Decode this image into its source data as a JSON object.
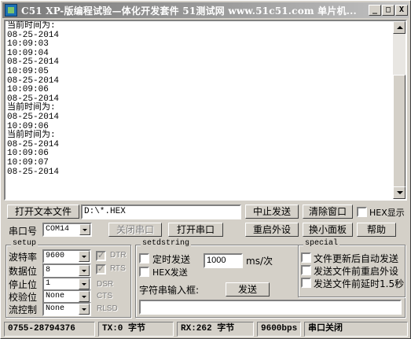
{
  "window": {
    "title": "C51 XP-版编程试验—体化开发套件 51测试网 www.51c51.com 单片机...",
    "min": "_",
    "max": "□",
    "close": "X"
  },
  "receive": {
    "lines": [
      "当前时间为:",
      "08-25-2014",
      "10:09:03",
      "10:09:04",
      "08-25-2014",
      "10:09:05",
      "08-25-2014",
      "10:09:06",
      "08-25-2014",
      "当前时间为:",
      "08-25-2014",
      "10:09:06",
      "当前时间为:",
      "08-25-2014",
      "10:09:06",
      "10:09:07",
      "08-25-2014"
    ]
  },
  "file_row": {
    "open_file": "打开文本文件",
    "path": "D:\\*.HEX",
    "stop_send": "中止发送",
    "clear_window": "清除窗口",
    "hex_display": "HEX显示"
  },
  "port_row": {
    "port_label": "串口号",
    "port_value": "COM14",
    "close_port": "关闭串口",
    "open_port": "打开串口",
    "restart": "重启外设",
    "switch_panel": "换小面板",
    "help": "帮助"
  },
  "setup": {
    "title": "setup",
    "baud_label": "波特率",
    "baud": "9600",
    "data_label": "数据位",
    "data": "8",
    "stop_label": "停止位",
    "stop": "1",
    "parity_label": "校验位",
    "parity": "None",
    "flow_label": "流控制",
    "flow": "None",
    "dtr": "DTR",
    "rts": "RTS",
    "dsr": "DSR",
    "cts": "CTS",
    "rlsd": "RLSD"
  },
  "setdstring": {
    "title": "setdstring",
    "timed_send": "定时发送",
    "interval": "1000",
    "unit": "ms/次",
    "hex_send": "HEX发送",
    "input_label": "字符串输入框:",
    "send": "发送",
    "input_value": ""
  },
  "special": {
    "title": "special",
    "opt1": "文件更新后自动发送",
    "opt2": "发送文件前重启外设",
    "opt3": "发送文件前延时1.5秒"
  },
  "statusbar": {
    "phone": "0755-28794376",
    "tx": "TX:0 字节",
    "rx": "RX:262 字节",
    "baud": "9600bps",
    "port_state": "串口关闭"
  }
}
